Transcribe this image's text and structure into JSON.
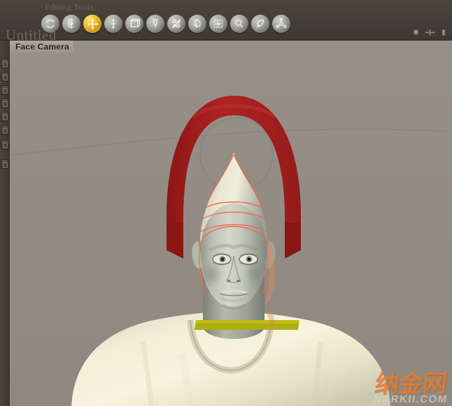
{
  "app": {
    "toolbar_title": "Editing Tools.",
    "document_title": "Untitled",
    "viewport_label": "Face Camera"
  },
  "toolbar": {
    "tools": [
      {
        "name": "rotate-tool",
        "label": "Rotate",
        "active": false
      },
      {
        "name": "scale-tool",
        "label": "Scale",
        "active": false
      },
      {
        "name": "move-tool",
        "label": "Move",
        "active": true
      },
      {
        "name": "translate-y-tool",
        "label": "Translate",
        "active": false
      },
      {
        "name": "resize-box-tool",
        "label": "Resize",
        "active": false
      },
      {
        "name": "chisel-tool",
        "label": "Chisel",
        "active": false
      },
      {
        "name": "morph-tool",
        "label": "Morph",
        "active": false
      },
      {
        "name": "paint-bucket-tool",
        "label": "Paint Bucket",
        "active": false
      },
      {
        "name": "region-select-tool",
        "label": "Region Select",
        "active": false
      },
      {
        "name": "magnify-tool",
        "label": "Magnify",
        "active": false
      },
      {
        "name": "brush-tool",
        "label": "Brush",
        "active": false
      },
      {
        "name": "joint-tool",
        "label": "Joint Editor",
        "active": false
      }
    ],
    "active_tool": "Move",
    "window_controls": [
      {
        "name": "camera-dot-icon",
        "label": "Camera"
      },
      {
        "name": "move-gizmo-icon",
        "label": "Move Gizmo"
      },
      {
        "name": "resize-grip-icon",
        "label": "Resize"
      }
    ]
  },
  "left_strip": {
    "label": "Parameter Dials",
    "buttons": [
      {
        "name": "strip-button-1"
      },
      {
        "name": "strip-button-2"
      },
      {
        "name": "strip-button-3"
      },
      {
        "name": "strip-button-4"
      },
      {
        "name": "strip-button-5"
      },
      {
        "name": "strip-button-6"
      },
      {
        "name": "strip-button-7"
      },
      {
        "name": "strip-button-8"
      }
    ]
  },
  "viewport": {
    "background_color": "#938c84",
    "scene": {
      "figure": {
        "skin_color": "#c9cbc0",
        "shirt_color": "#efecd6",
        "wireframe_color": "#ff6f50"
      },
      "prop_arch": {
        "name": "red-arch-prop",
        "color": "#a81f1f"
      },
      "neck_band": {
        "name": "neck-band-selection",
        "color": "#b0ad12"
      },
      "guide_circle": {
        "name": "guide-circle",
        "color": "#7d7770"
      },
      "horizon_line": {
        "name": "ground-horizon-line",
        "color": "#8b857d"
      }
    }
  },
  "watermark": {
    "chinese": "纳金网",
    "latin": "NARKII.COM",
    "color": "#e8792a"
  }
}
